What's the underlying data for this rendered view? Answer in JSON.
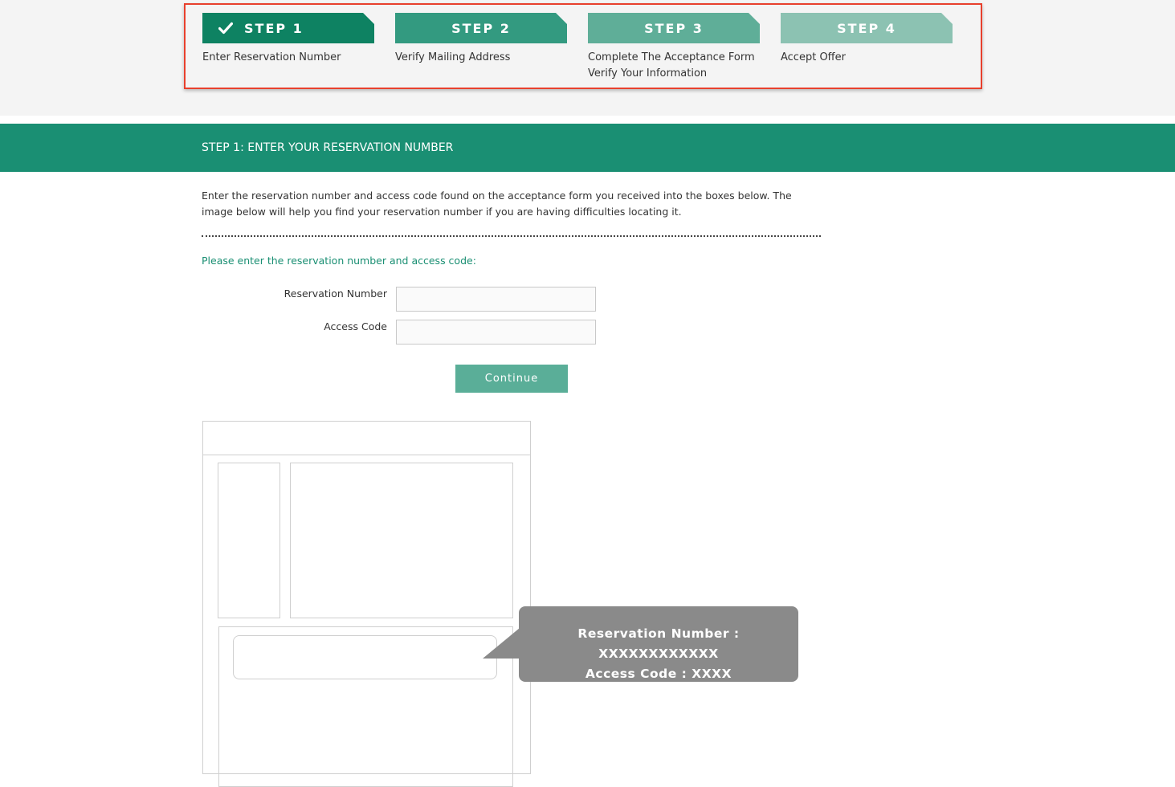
{
  "steps": [
    {
      "label": "STEP 1",
      "description": "Enter Reservation Number",
      "completed": true,
      "color": "#0e8262"
    },
    {
      "label": "STEP 2",
      "description": "Verify Mailing Address",
      "color": "#339a80"
    },
    {
      "label": "STEP 3",
      "description": "Complete The Acceptance Form",
      "description_line2": "Verify Your Information",
      "color": "#5fae98"
    },
    {
      "label": "STEP 4",
      "description": "Accept Offer",
      "color": "#8cc2b2"
    }
  ],
  "section": {
    "title": "STEP 1: ENTER YOUR RESERVATION NUMBER",
    "intro": "Enter the reservation number and access code found on the acceptance form you received into the boxes below. The image below will help you find your reservation number if you are having difficulties locating it.",
    "prompt": "Please enter the reservation number and access code:"
  },
  "form": {
    "reservation_label": "Reservation Number",
    "reservation_value": "",
    "access_label": "Access Code",
    "access_value": "",
    "continue_label": "Continue"
  },
  "callout": {
    "line1": "Reservation Number : XXXXXXXXXXXX",
    "line2": "Access Code  : XXXX"
  },
  "colors": {
    "accent": "#1a8f73",
    "highlight_border": "#e8402d",
    "button": "#5aae98",
    "callout": "#8a8a8a"
  }
}
